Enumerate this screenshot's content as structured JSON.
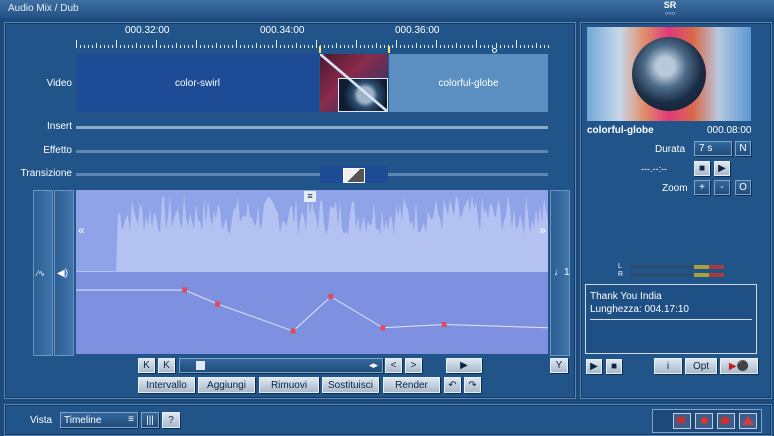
{
  "window": {
    "title": "Audio Mix / Dub",
    "sr_label_top": "SR",
    "sr_label_bottom": "○○○"
  },
  "ruler": {
    "times": [
      "000.32:00",
      "000.34:00",
      "000.36:00"
    ]
  },
  "tracks": {
    "video_label": "Video",
    "insert_label": "Insert",
    "effect_label": "Effetto",
    "transition_label": "Transizione",
    "clips": [
      "color-swirl",
      "colorful-globe"
    ]
  },
  "audio": {
    "left_small": "⁄∿",
    "speaker": "◀)",
    "right_note": "♩1",
    "arrow_left": "«",
    "arrow_right": "»",
    "handle": "≡",
    "envelope_points": [
      [
        0,
        0.22
      ],
      [
        0.23,
        0.22
      ],
      [
        0.3,
        0.39
      ],
      [
        0.46,
        0.72
      ],
      [
        0.54,
        0.3
      ],
      [
        0.65,
        0.68
      ],
      [
        0.78,
        0.64
      ],
      [
        1,
        0.68
      ]
    ]
  },
  "transport": {
    "first": "K",
    "prev": "K",
    "scroll": "◂▸",
    "left": "<",
    "right": ">",
    "play": "▶",
    "edit_icon": "Y"
  },
  "actions": {
    "intervallo": "Intervallo",
    "aggiungi": "Aggiungi",
    "rimuovi": "Rimuovi",
    "sostituisci": "Sostituisci",
    "render": "Render",
    "undo": "↶",
    "redo": "↷"
  },
  "preview": {
    "clip_name": "colorful-globe",
    "clip_time": "000.08:00",
    "durata_label": "Durata",
    "durata_value": "7 s",
    "n_button": "N",
    "dashes": "---.--:--",
    "stop": "■",
    "mark": "▶",
    "zoom_label": "Zoom",
    "zoom_plus": "+",
    "zoom_minus": "-",
    "zoom_o": "O"
  },
  "meter": {
    "left": "L",
    "right": "R"
  },
  "info": {
    "line1": "Thank You India",
    "line2": "Lunghezza: 004.17:10"
  },
  "player": {
    "play": "▶",
    "stop": "■",
    "info": "i",
    "opt": "Opt",
    "rec": "▶⚫"
  },
  "footer": {
    "vista_label": "Vista",
    "vista_value": "Timeline",
    "menu": "≡",
    "bars": "|||",
    "help": "?"
  },
  "colors": {
    "background": "#1c4a7a",
    "clip_blue": "#1e4b96",
    "clip_light": "#5b8fc2",
    "wave": "#8fa3e8",
    "envelope_point": "#e04a5a"
  }
}
